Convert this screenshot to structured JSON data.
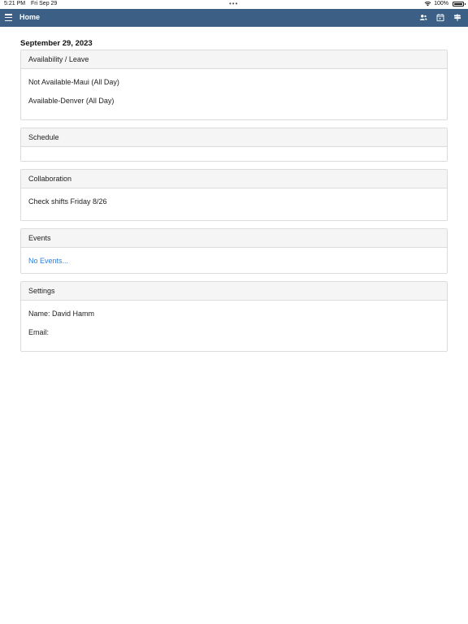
{
  "status_bar": {
    "time": "5:21 PM",
    "date": "Fri Sep 29",
    "dots": "•••",
    "battery_percent": "100%",
    "battery_level": 1.0
  },
  "navbar": {
    "title": "Home",
    "background_color": "#3c6085",
    "icons": [
      "menu-icon",
      "contacts-icon",
      "calendar-icon",
      "signpost-icon"
    ]
  },
  "content": {
    "date_heading": "September 29, 2023",
    "panels": {
      "availability": {
        "title": "Availability / Leave",
        "lines": [
          "Not Available-Maui (All Day)",
          "Available-Denver (All Day)"
        ]
      },
      "schedule": {
        "title": "Schedule",
        "lines": []
      },
      "collaboration": {
        "title": "Collaboration",
        "lines": [
          "Check shifts Friday 8/26"
        ]
      },
      "events": {
        "title": "Events",
        "link": "No Events..."
      },
      "settings": {
        "title": "Settings",
        "lines": [
          "Name: David Hamm",
          "Email:"
        ]
      }
    }
  },
  "colors": {
    "accent": "#3c6085",
    "link": "#2f7ed8",
    "panel_header_bg": "#f5f5f5",
    "panel_border": "#dcdcdc"
  }
}
